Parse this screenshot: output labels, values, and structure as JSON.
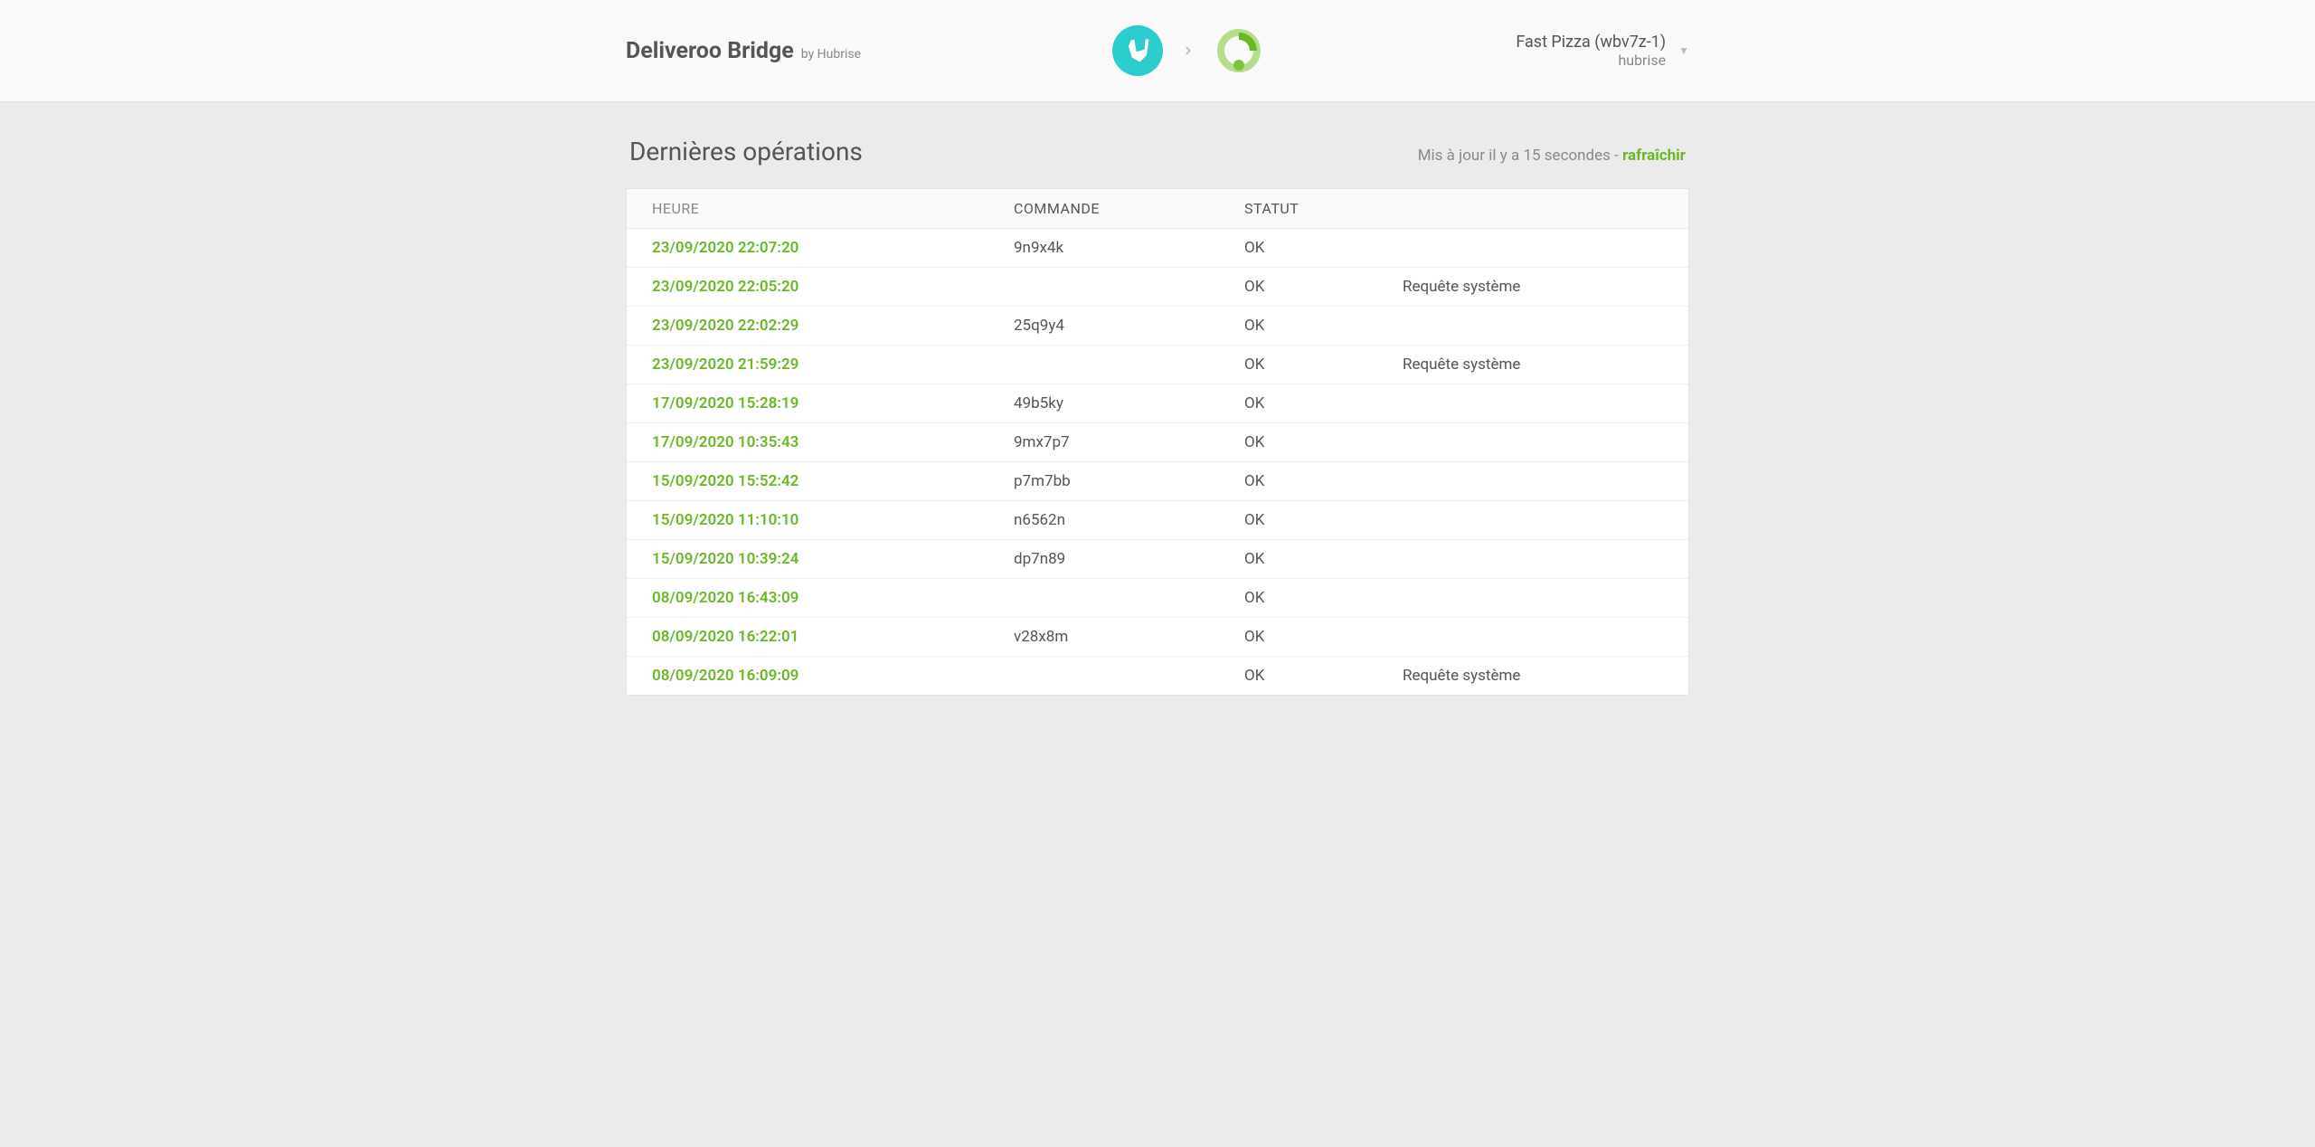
{
  "header": {
    "title": "Deliveroo Bridge",
    "byline": "by Hubrise",
    "account_name": "Fast Pizza (wbv7z-1)",
    "account_org": "hubrise"
  },
  "page": {
    "title": "Dernières opérations",
    "updated_prefix": "Mis à jour il y a 15 secondes - ",
    "refresh_label": "rafraîchir"
  },
  "table": {
    "headers": {
      "time": "HEURE",
      "order": "COMMANDE",
      "status": "STATUT"
    },
    "rows": [
      {
        "time": "23/09/2020 22:07:20",
        "order": "9n9x4k",
        "status": "OK",
        "note": ""
      },
      {
        "time": "23/09/2020 22:05:20",
        "order": "",
        "status": "OK",
        "note": "Requête système"
      },
      {
        "time": "23/09/2020 22:02:29",
        "order": "25q9y4",
        "status": "OK",
        "note": ""
      },
      {
        "time": "23/09/2020 21:59:29",
        "order": "",
        "status": "OK",
        "note": "Requête système"
      },
      {
        "time": "17/09/2020 15:28:19",
        "order": "49b5ky",
        "status": "OK",
        "note": ""
      },
      {
        "time": "17/09/2020 10:35:43",
        "order": "9mx7p7",
        "status": "OK",
        "note": ""
      },
      {
        "time": "15/09/2020 15:52:42",
        "order": "p7m7bb",
        "status": "OK",
        "note": ""
      },
      {
        "time": "15/09/2020 11:10:10",
        "order": "n6562n",
        "status": "OK",
        "note": ""
      },
      {
        "time": "15/09/2020 10:39:24",
        "order": "dp7n89",
        "status": "OK",
        "note": ""
      },
      {
        "time": "08/09/2020 16:43:09",
        "order": "",
        "status": "OK",
        "note": ""
      },
      {
        "time": "08/09/2020 16:22:01",
        "order": "v28x8m",
        "status": "OK",
        "note": ""
      },
      {
        "time": "08/09/2020 16:09:09",
        "order": "",
        "status": "OK",
        "note": "Requête système"
      }
    ]
  }
}
